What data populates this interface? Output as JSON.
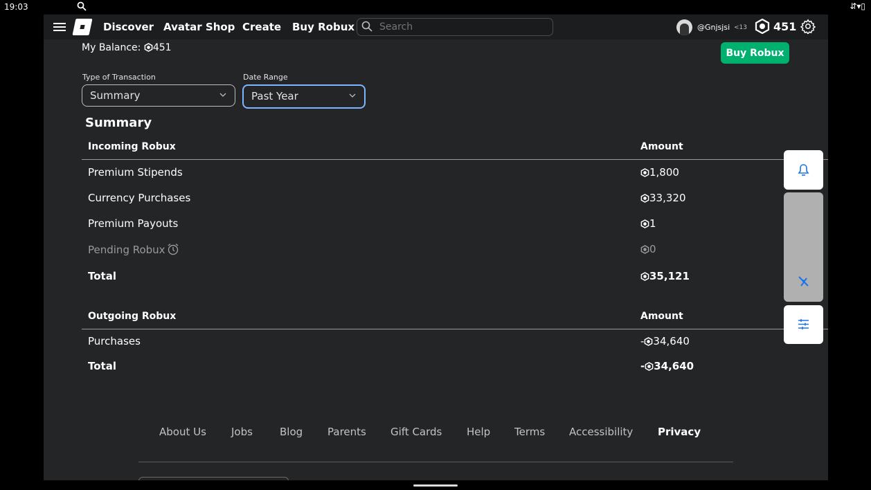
{
  "status_bar": {
    "time": "19:03"
  },
  "nav": {
    "links": [
      "Discover",
      "Avatar Shop",
      "Create",
      "Buy Robux"
    ],
    "search_placeholder": "Search",
    "username": "@Gnjsjsi",
    "age_tag": "<13",
    "robux_count": "451"
  },
  "balance": {
    "label": "My Balance:",
    "amount": "451"
  },
  "buy_button": "Buy Robux",
  "filters": {
    "type_label": "Type of Transaction",
    "type_value": "Summary",
    "date_label": "Date Range",
    "date_value": "Past Year"
  },
  "summary": {
    "title": "Summary",
    "incoming": {
      "header": "Incoming Robux",
      "amount_header": "Amount",
      "rows": [
        {
          "label": "Premium Stipends",
          "amount": "1,800"
        },
        {
          "label": "Currency Purchases",
          "amount": "33,320"
        },
        {
          "label": "Premium Payouts",
          "amount": "1"
        },
        {
          "label": "Pending Robux",
          "amount": "0"
        },
        {
          "label": "Total",
          "amount": "35,121"
        }
      ]
    },
    "outgoing": {
      "header": "Outgoing Robux",
      "amount_header": "Amount",
      "rows": [
        {
          "label": "Purchases",
          "amount": "34,640",
          "sign": "-"
        },
        {
          "label": "Total",
          "amount": "34,640",
          "sign": "-"
        }
      ]
    }
  },
  "footer": {
    "links": [
      "About Us",
      "Jobs",
      "Blog",
      "Parents",
      "Gift Cards",
      "Help",
      "Terms",
      "Accessibility",
      "Privacy"
    ]
  },
  "colors": {
    "accent_green": "#00b06f",
    "page_bg": "#232527",
    "focus_blue": "#7eb6ff"
  },
  "icons": [
    "search-icon",
    "robux-icon",
    "gear-icon",
    "bell-icon",
    "tune-icon",
    "clock-icon",
    "chevron-down-icon"
  ]
}
